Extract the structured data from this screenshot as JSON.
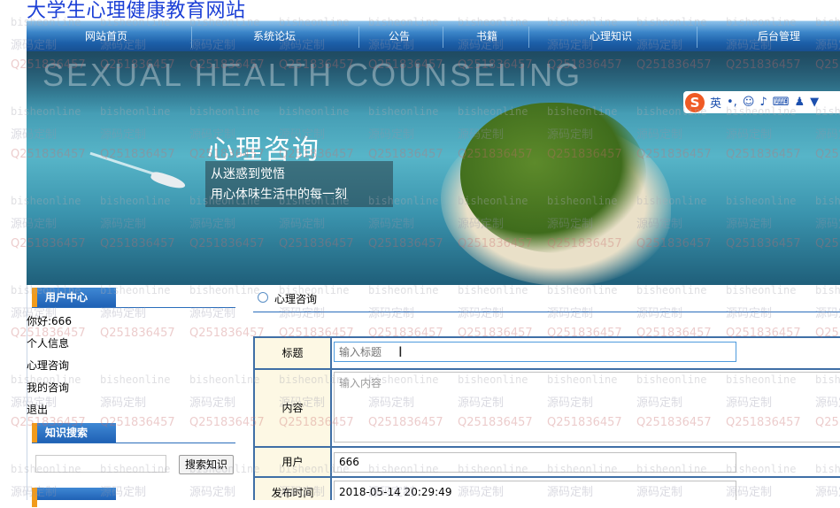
{
  "site_title": "大学生心理健康教育网站",
  "nav": [
    {
      "label": "网站首页"
    },
    {
      "label": "系统论坛"
    },
    {
      "label": "公告"
    },
    {
      "label": "书籍"
    },
    {
      "label": "心理知识"
    },
    {
      "label": "后台管理"
    }
  ],
  "banner": {
    "english": "SEXUAL HEALTH COUNSELING",
    "title": "心理咨询",
    "line1": "从迷惑到觉悟",
    "line2": "用心体味生活中的每一刻"
  },
  "ime": {
    "lang": "英",
    "punct": "•,"
  },
  "sidebar": {
    "user_center_title": "用户中心",
    "greeting": "你好:666",
    "links": [
      "个人信息",
      "心理咨询",
      "我的咨询",
      "退出"
    ],
    "search_title": "知识搜索",
    "search_button": "搜索知识"
  },
  "main": {
    "breadcrumb": "心理咨询",
    "form": {
      "title_label": "标题",
      "title_placeholder": "输入标题",
      "content_label": "内容",
      "content_placeholder": "输入内容",
      "user_label": "用户",
      "user_value": "666",
      "time_label": "发布时间",
      "time_value": "2018-05-14 20:29:49"
    }
  },
  "watermark": {
    "line1": "bisheonline",
    "line2": "源码定制",
    "line3": "Q251836457"
  },
  "colors": {
    "nav_blue": "#1c5fa8",
    "title_blue": "#1b3fd6",
    "label_bg": "#fdf8e4",
    "accent_orange": "#f19b1c"
  }
}
